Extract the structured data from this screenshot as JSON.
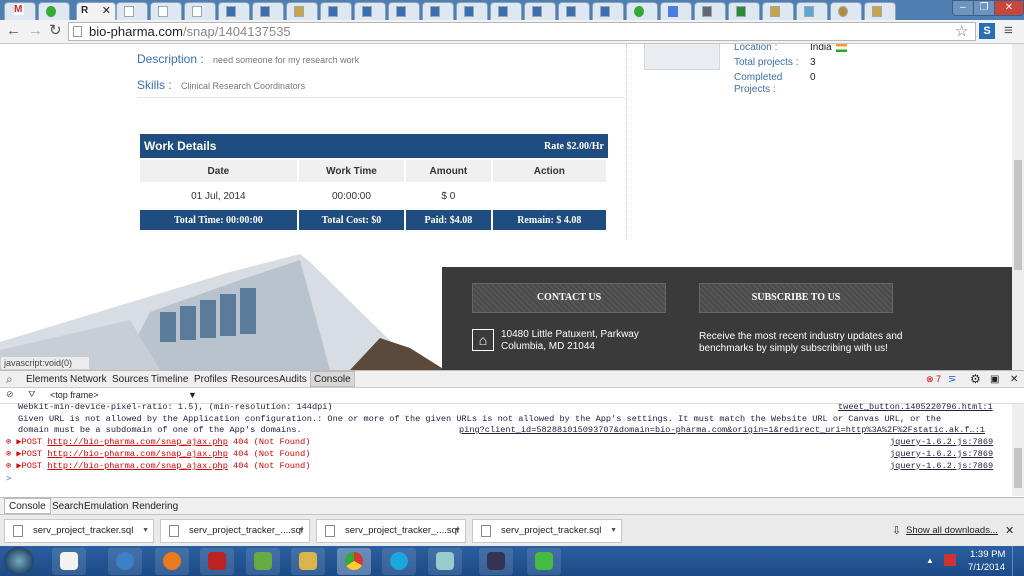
{
  "browser": {
    "active_tab_label": "R",
    "url_host": "bio-pharma.com",
    "url_path": "/snap/1404137535",
    "tab_count": 26
  },
  "profile": {
    "location_label": "Location :",
    "location_value": "India",
    "total_projects_label": "Total projects :",
    "total_projects_value": "3",
    "completed_label": "Completed Projects :",
    "completed_value": "0"
  },
  "details": {
    "description_label": "Description :",
    "description_value": "need someone for my research work",
    "skills_label": "Skills :",
    "skills_value": "Clinical Research Coordinators"
  },
  "work": {
    "title": "Work Details",
    "rate": "Rate $2.00/Hr",
    "columns": [
      "Date",
      "Work Time",
      "Amount",
      "Action"
    ],
    "row": [
      "01 Jul, 2014",
      "00:00:00",
      "$ 0",
      ""
    ],
    "footer": [
      "Total Time: 00:00:00",
      "Total Cost: $0",
      "Paid: $4.08",
      "Remain: $ 4.08"
    ]
  },
  "footer": {
    "contact_label": "CONTACT US",
    "subscribe_label": "SUBSCRIBE TO US",
    "address_line1": "10480 Little Patuxent, Parkway",
    "address_line2": "Columbia, MD 21044",
    "subscribe_text_line1": "Receive the most recent industry updates and",
    "subscribe_text_line2": "benchmarks by simply subscribing with us!"
  },
  "status_url": "javascript:void(0)",
  "devtools": {
    "tabs": [
      "Elements",
      "Network",
      "Sources",
      "Timeline",
      "Profiles",
      "Resources",
      "Audits",
      "Console"
    ],
    "active_tab": "Console",
    "error_count": "7",
    "frame_select": "<top frame>",
    "console_lines": {
      "line0": "Webkit-min-device-pixel-ratio: 1.5), (min-resolution: 144dpi)",
      "line0_src": "tweet_button.1405220796.html:1",
      "line1": "Given URL is not allowed by the Application configuration.: One or more of the given URLs is not allowed by the App's settings.  It must match the Website URL or Canvas URL, or the",
      "line2": "domain must be a subdomain of one of the App's domains.",
      "line2_src": "ping?client_id=582881015093707&domain=bio-pharma.com&origin=1&redirect_uri=http%3A%2F%2Fstatic.ak.f…:1",
      "errors": [
        {
          "method": "POST",
          "url": "http://bio-pharma.com/snap_ajax.php",
          "status": "404 (Not Found)",
          "src": "jquery-1.6.2.js:7869"
        },
        {
          "method": "POST",
          "url": "http://bio-pharma.com/snap_ajax.php",
          "status": "404 (Not Found)",
          "src": "jquery-1.6.2.js:7869"
        },
        {
          "method": "POST",
          "url": "http://bio-pharma.com/snap_ajax.php",
          "status": "404 (Not Found)",
          "src": "jquery-1.6.2.js:7869"
        }
      ],
      "prompt": ">"
    },
    "drawer_tabs": [
      "Console",
      "Search",
      "Emulation",
      "Rendering"
    ]
  },
  "downloads": {
    "items": [
      "serv_project_tracker.sql",
      "serv_project_tracker_....sql",
      "serv_project_tracker_....sql",
      "serv_project_tracker.sql"
    ],
    "show_all": "Show all downloads..."
  },
  "taskbar": {
    "time": "1:39 PM",
    "date": "7/1/2014"
  },
  "colors": {
    "header_blue": "#1f4d7f",
    "label_blue": "#3a6fb0",
    "error_red": "#dd0000",
    "footer_dark": "#3a3a3a"
  }
}
